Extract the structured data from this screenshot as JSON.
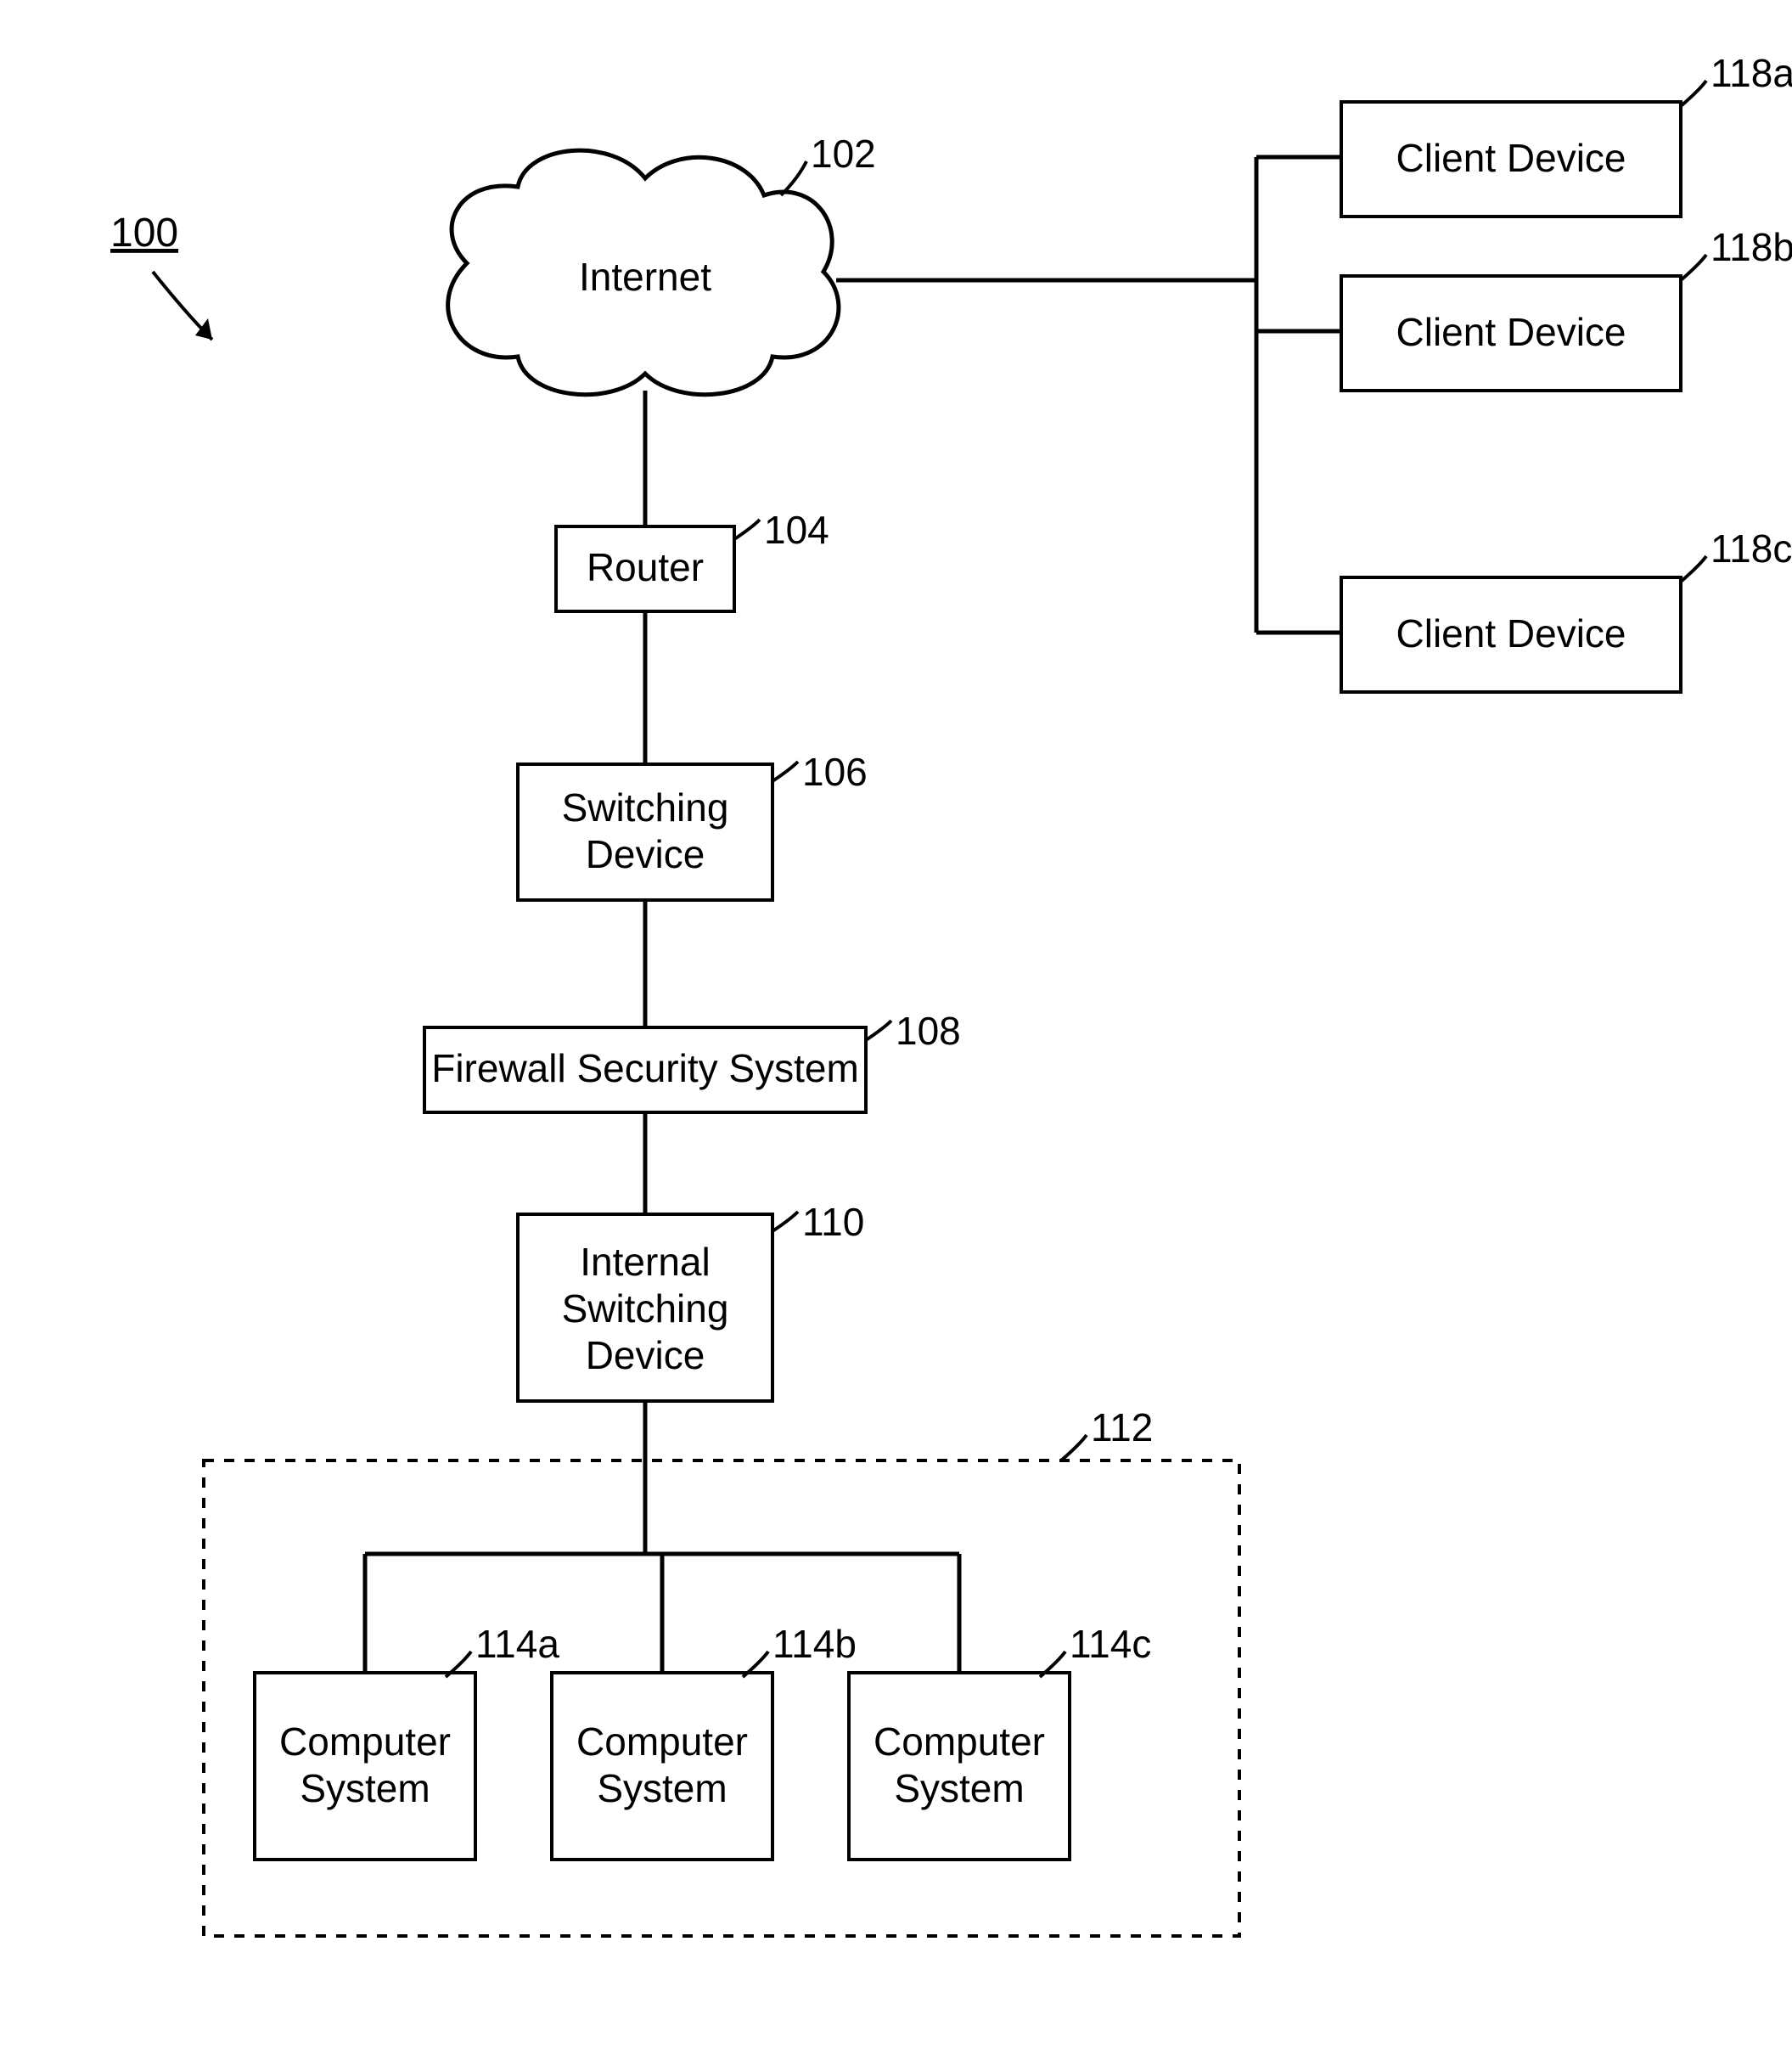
{
  "figure_ref": "100",
  "cloud": {
    "label": "Internet",
    "ref": "102"
  },
  "router": {
    "label": "Router",
    "ref": "104"
  },
  "switching": {
    "line1": "Switching",
    "line2": "Device",
    "ref": "106"
  },
  "firewall": {
    "label": "Firewall Security System",
    "ref": "108"
  },
  "internal_switching": {
    "line1": "Internal",
    "line2": "Switching",
    "line3": "Device",
    "ref": "110"
  },
  "cluster_ref": "112",
  "computers": [
    {
      "line1": "Computer",
      "line2": "System",
      "ref": "114a"
    },
    {
      "line1": "Computer",
      "line2": "System",
      "ref": "114b"
    },
    {
      "line1": "Computer",
      "line2": "System",
      "ref": "114c"
    }
  ],
  "clients": [
    {
      "label": "Client Device",
      "ref": "118a"
    },
    {
      "label": "Client Device",
      "ref": "118b"
    },
    {
      "label": "Client Device",
      "ref": "118c"
    }
  ]
}
